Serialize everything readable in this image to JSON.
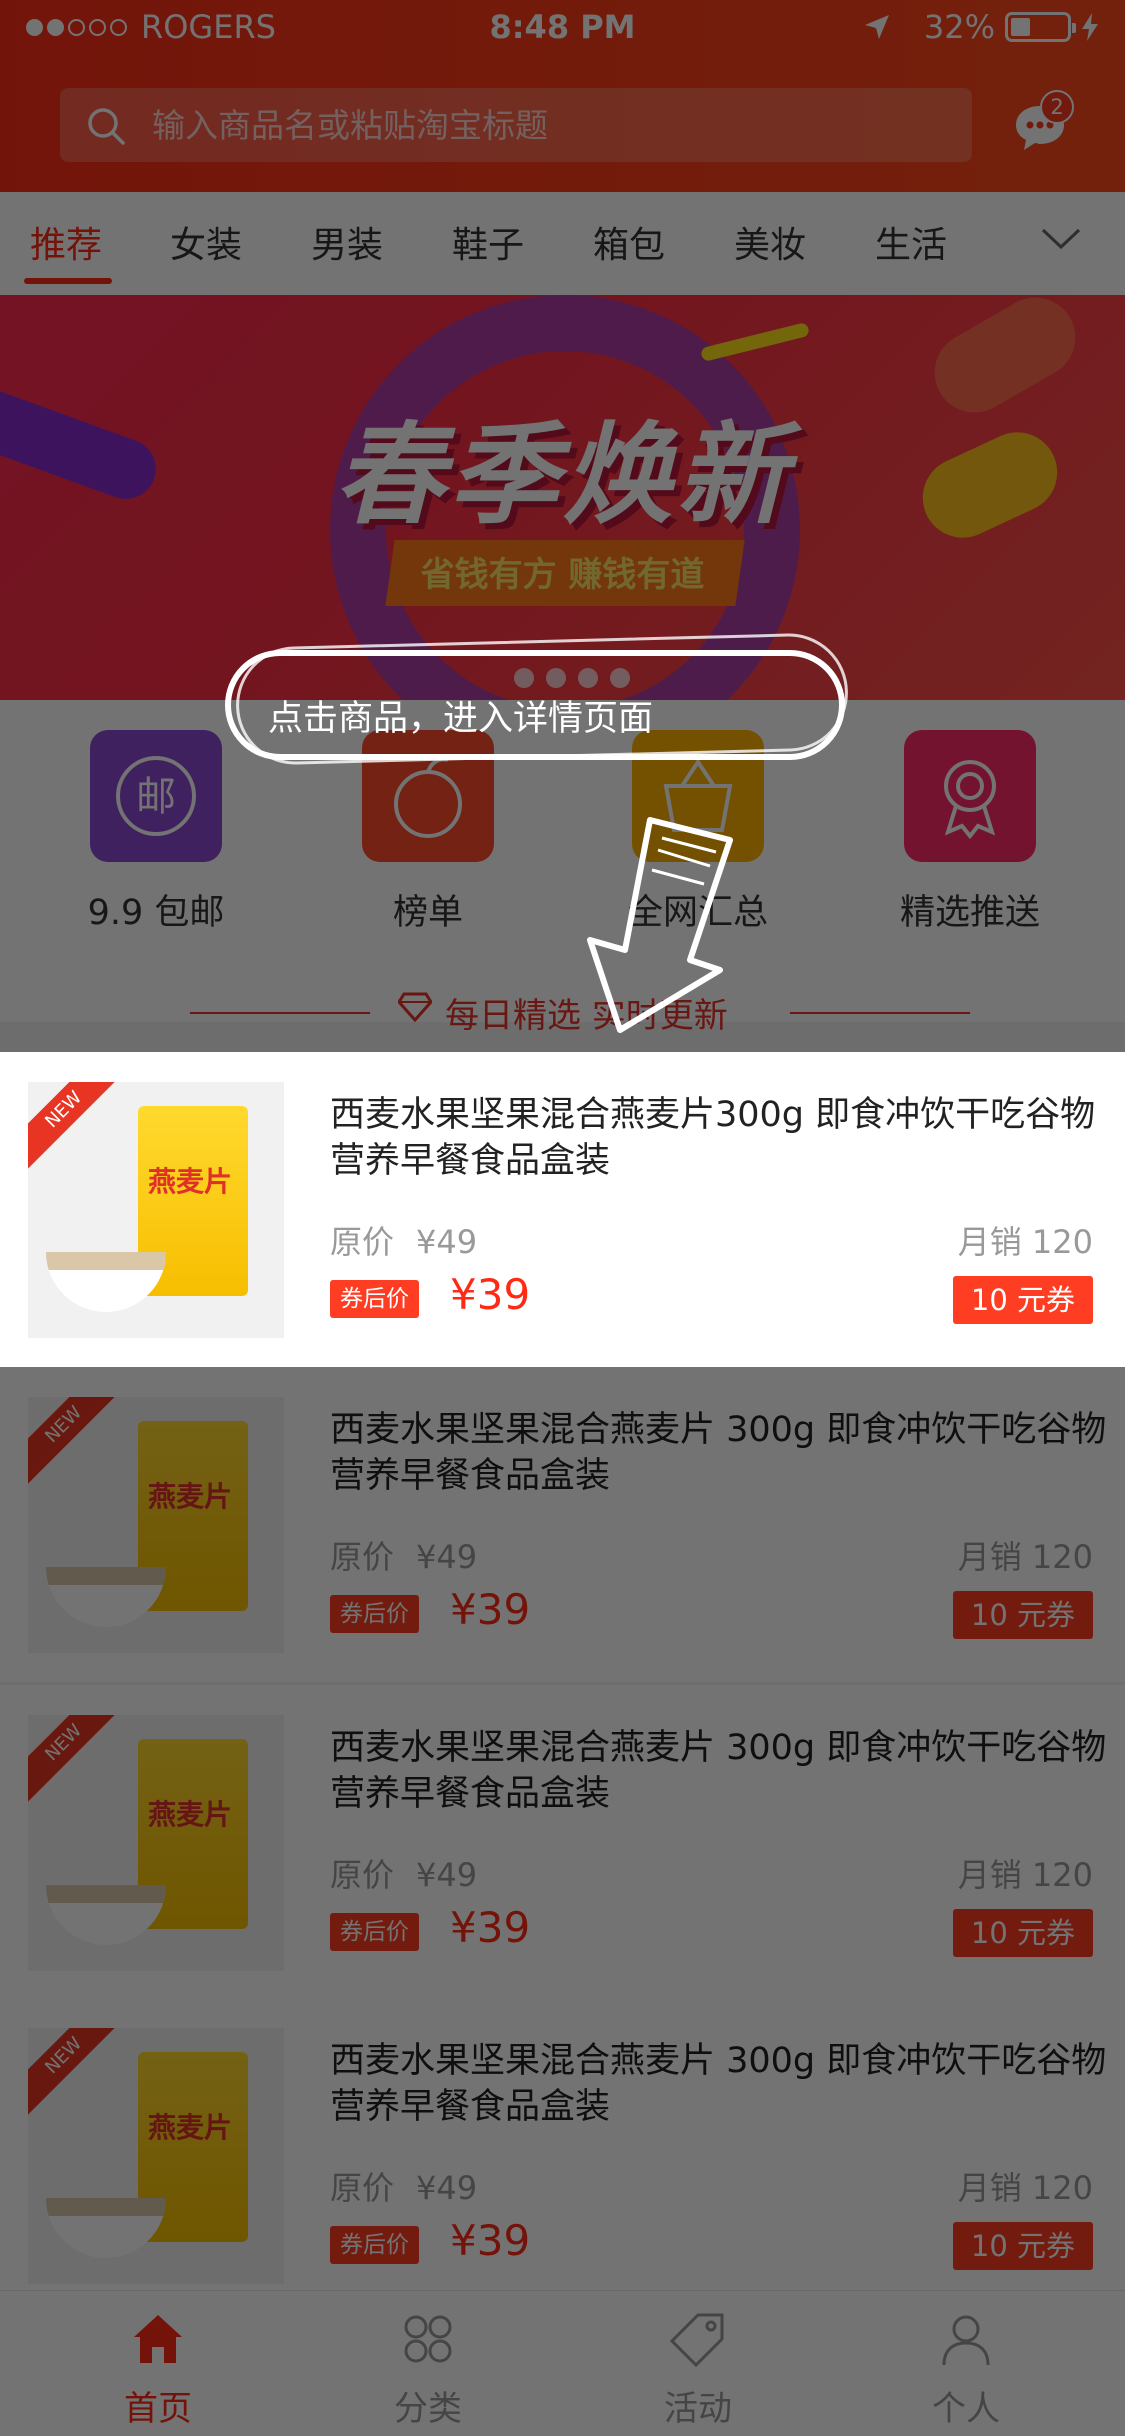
{
  "status": {
    "carrier": "ROGERS",
    "time": "8:48 PM",
    "battery": "32%"
  },
  "search": {
    "placeholder": "输入商品名或粘贴淘宝标题"
  },
  "messages": {
    "badge": "2"
  },
  "tabs": [
    "推荐",
    "女装",
    "男装",
    "鞋子",
    "箱包",
    "美妆",
    "生活"
  ],
  "banner": {
    "title": "春季焕新",
    "subtitle": "省钱有方 赚钱有道"
  },
  "quick": [
    {
      "label": "9.9 包邮",
      "color": "#8e4bd6",
      "icon": "mail-icon"
    },
    {
      "label": "榜单",
      "color": "#ff4c2e",
      "icon": "fruit-icon"
    },
    {
      "label": "全网汇总",
      "color": "#ffb300",
      "icon": "basket-icon"
    },
    {
      "label": "精选推送",
      "color": "#ff2a6a",
      "icon": "award-icon"
    }
  ],
  "section": {
    "title": "每日精选 实时更新"
  },
  "guide": {
    "text": "点击商品，进入详情页面"
  },
  "products": [
    {
      "title": "西麦水果坚果混合燕麦片300g 即食冲饮干吃谷物营养早餐食品盒装",
      "orig_label": "原价",
      "orig_price": "¥49",
      "sales": "月销 120",
      "coupon_tag": "券后价",
      "price": "¥39",
      "coupon": "10 元券",
      "badge": "NEW",
      "pack_text": "燕麦片"
    },
    {
      "title": "西麦水果坚果混合燕麦片 300g 即食冲饮干吃谷物营养早餐食品盒装",
      "orig_label": "原价",
      "orig_price": "¥49",
      "sales": "月销 120",
      "coupon_tag": "券后价",
      "price": "¥39",
      "coupon": "10 元券",
      "badge": "NEW",
      "pack_text": "燕麦片"
    },
    {
      "title": "西麦水果坚果混合燕麦片 300g 即食冲饮干吃谷物营养早餐食品盒装",
      "orig_label": "原价",
      "orig_price": "¥49",
      "sales": "月销 120",
      "coupon_tag": "券后价",
      "price": "¥39",
      "coupon": "10 元券",
      "badge": "NEW",
      "pack_text": "燕麦片"
    },
    {
      "title": "西麦水果坚果混合燕麦片 300g 即食冲饮干吃谷物营养早餐食品盒装",
      "orig_label": "原价",
      "orig_price": "¥49",
      "sales": "月销 120",
      "coupon_tag": "券后价",
      "price": "¥39",
      "coupon": "10 元券",
      "badge": "NEW",
      "pack_text": "燕麦片"
    }
  ],
  "tabbar": [
    {
      "label": "首页",
      "icon": "home-icon",
      "active": true
    },
    {
      "label": "分类",
      "icon": "category-icon",
      "active": false
    },
    {
      "label": "活动",
      "icon": "tag-icon",
      "active": false
    },
    {
      "label": "个人",
      "icon": "user-icon",
      "active": false
    }
  ],
  "colors": {
    "accent": "#ff2a14",
    "header": "#ff3b1f"
  }
}
